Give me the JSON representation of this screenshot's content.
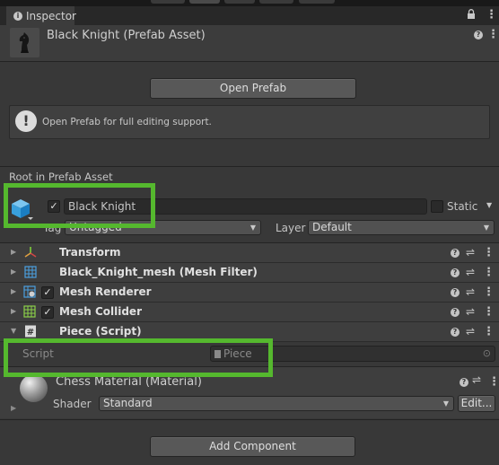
{
  "window": {
    "tab_label": "Inspector",
    "tab_icon": "info-icon",
    "lock_icon": "lock-icon",
    "menu_icon": "kebab-menu-icon"
  },
  "header": {
    "title": "Black Knight (Prefab Asset)",
    "thumbnail_icon": "black-knight-chess-piece",
    "open_prefab_label": "Open Prefab",
    "help_message": "Open Prefab for full editing support."
  },
  "root": {
    "section_label": "Root in Prefab Asset",
    "object_name": "Black Knight",
    "active_checked": true,
    "static_label": "Static",
    "static_checked": false,
    "tag_label": "Tag",
    "tag_value": "Untagged",
    "layer_label": "Layer",
    "layer_value": "Default"
  },
  "components": [
    {
      "name": "Transform",
      "icon": "transform-icon",
      "has_checkbox": false
    },
    {
      "name": "Black_Knight_mesh (Mesh Filter)",
      "icon": "mesh-filter-icon",
      "has_checkbox": false
    },
    {
      "name": "Mesh Renderer",
      "icon": "mesh-renderer-icon",
      "has_checkbox": true
    },
    {
      "name": "Mesh Collider",
      "icon": "mesh-collider-icon",
      "has_checkbox": true
    },
    {
      "name": "Piece (Script)",
      "icon": "script-icon",
      "has_checkbox": false
    }
  ],
  "script_field": {
    "label": "Script",
    "value": "Piece"
  },
  "material": {
    "title": "Chess Material (Material)",
    "shader_label": "Shader",
    "shader_value": "Standard",
    "edit_label": "Edit..."
  },
  "footer": {
    "add_component_label": "Add Component"
  },
  "colors": {
    "highlight": "#55b82e",
    "background": "#383838"
  }
}
